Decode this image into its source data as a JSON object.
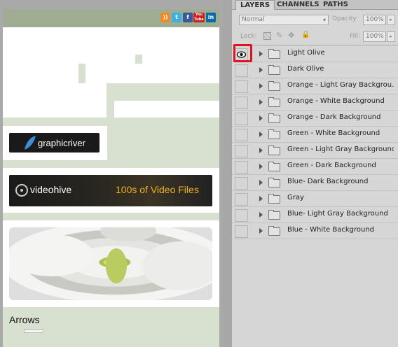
{
  "site": {
    "social_icons": [
      "rss-icon",
      "twitter-icon",
      "facebook-icon",
      "youtube-icon",
      "linkedin-icon"
    ],
    "social_labels": {
      "rss": "))",
      "twitter": "t",
      "facebook": "f",
      "youtube": "You Tube",
      "linkedin": "in"
    },
    "banners": {
      "graphicriver": "graphicriver",
      "videohive": "videohive",
      "videohive_tagline": "100s of Video Files"
    },
    "arrows_heading": "Arrows"
  },
  "panel": {
    "tabs": [
      "LAYERS",
      "CHANNELS",
      "PATHS"
    ],
    "active_tab": "LAYERS",
    "blend_mode": "Normal",
    "opacity_label": "Opacity:",
    "opacity_value": "100%",
    "lock_label": "Lock:",
    "fill_label": "Fill:",
    "fill_value": "100%",
    "layers": [
      {
        "name": "Light Olive",
        "visible": true
      },
      {
        "name": "Dark Olive",
        "visible": false
      },
      {
        "name": "Orange - Light Gray Backgrou...",
        "visible": false
      },
      {
        "name": "Orange - White Background",
        "visible": false
      },
      {
        "name": "Orange - Dark Background",
        "visible": false
      },
      {
        "name": "Green - White Background",
        "visible": false
      },
      {
        "name": "Green - Light Gray Background",
        "visible": false
      },
      {
        "name": "Green - Dark Background",
        "visible": false
      },
      {
        "name": "Blue- Dark Background",
        "visible": false
      },
      {
        "name": "Gray",
        "visible": false
      },
      {
        "name": "Blue- Light Gray Background",
        "visible": false
      },
      {
        "name": "Blue - White Background",
        "visible": false
      }
    ],
    "highlight_color": "#e0141e"
  }
}
